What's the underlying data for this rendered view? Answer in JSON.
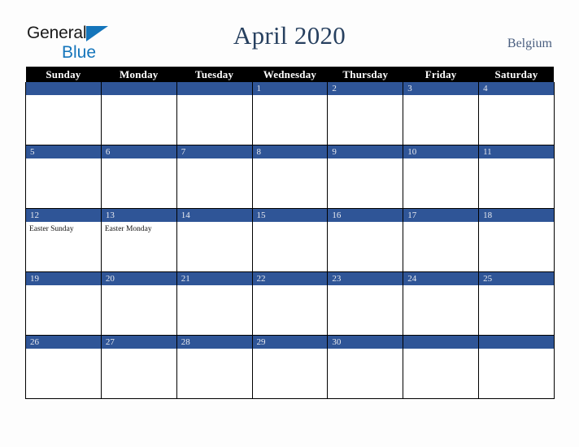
{
  "brand": {
    "name_part1": "General",
    "name_part2": "Blue",
    "triangle_color": "#1475bb",
    "text_color": "#1a1a1a"
  },
  "header": {
    "title": "April 2020",
    "country": "Belgium",
    "title_color": "#27405f",
    "country_color": "#4a5f80"
  },
  "calendar": {
    "header_bg": "#000000",
    "header_text_color": "#ffffff",
    "date_band_color": "#2f5597",
    "date_text_color": "#e8eaf0",
    "cell_bg": "#ffffff",
    "weekdays": [
      "Sunday",
      "Monday",
      "Tuesday",
      "Wednesday",
      "Thursday",
      "Friday",
      "Saturday"
    ],
    "weeks": [
      [
        {
          "date": "",
          "events": []
        },
        {
          "date": "",
          "events": []
        },
        {
          "date": "",
          "events": []
        },
        {
          "date": "1",
          "events": []
        },
        {
          "date": "2",
          "events": []
        },
        {
          "date": "3",
          "events": []
        },
        {
          "date": "4",
          "events": []
        }
      ],
      [
        {
          "date": "5",
          "events": []
        },
        {
          "date": "6",
          "events": []
        },
        {
          "date": "7",
          "events": []
        },
        {
          "date": "8",
          "events": []
        },
        {
          "date": "9",
          "events": []
        },
        {
          "date": "10",
          "events": []
        },
        {
          "date": "11",
          "events": []
        }
      ],
      [
        {
          "date": "12",
          "events": [
            "Easter Sunday"
          ]
        },
        {
          "date": "13",
          "events": [
            "Easter Monday"
          ]
        },
        {
          "date": "14",
          "events": []
        },
        {
          "date": "15",
          "events": []
        },
        {
          "date": "16",
          "events": []
        },
        {
          "date": "17",
          "events": []
        },
        {
          "date": "18",
          "events": []
        }
      ],
      [
        {
          "date": "19",
          "events": []
        },
        {
          "date": "20",
          "events": []
        },
        {
          "date": "21",
          "events": []
        },
        {
          "date": "22",
          "events": []
        },
        {
          "date": "23",
          "events": []
        },
        {
          "date": "24",
          "events": []
        },
        {
          "date": "25",
          "events": []
        }
      ],
      [
        {
          "date": "26",
          "events": []
        },
        {
          "date": "27",
          "events": []
        },
        {
          "date": "28",
          "events": []
        },
        {
          "date": "29",
          "events": []
        },
        {
          "date": "30",
          "events": []
        },
        {
          "date": "",
          "events": []
        },
        {
          "date": "",
          "events": []
        }
      ]
    ]
  }
}
